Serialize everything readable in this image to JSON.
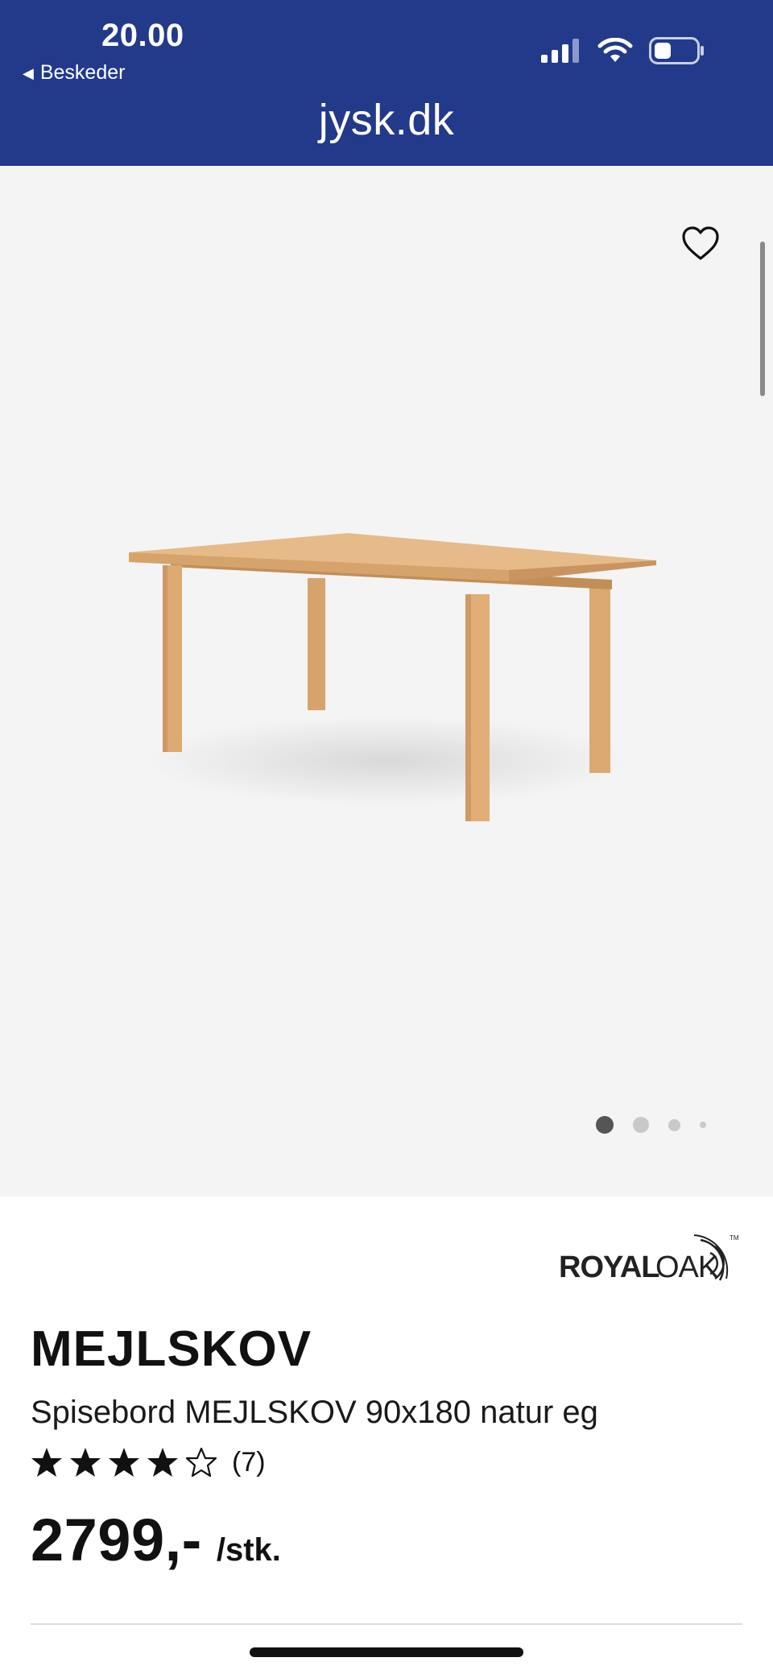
{
  "status_bar": {
    "time": "20.00",
    "back_label": "Beskeder",
    "icons": [
      "signal-icon",
      "wifi-icon",
      "battery-icon"
    ]
  },
  "browser": {
    "url": "jysk.dk"
  },
  "gallery": {
    "favorite_icon": "heart-icon",
    "image": "dining-table",
    "dots_total": 4,
    "active_dot": 1
  },
  "product": {
    "brand": "ROYAL OAK",
    "name": "MEJLSKOV",
    "description": "Spisebord MEJLSKOV 90x180 natur eg",
    "rating": 4,
    "rating_max": 5,
    "review_count": "(7)",
    "price": "2799,-",
    "unit": "/stk."
  },
  "colors": {
    "header": "#233a8a",
    "gallery_bg": "#f4f4f4",
    "wood": "#dfb27f"
  }
}
